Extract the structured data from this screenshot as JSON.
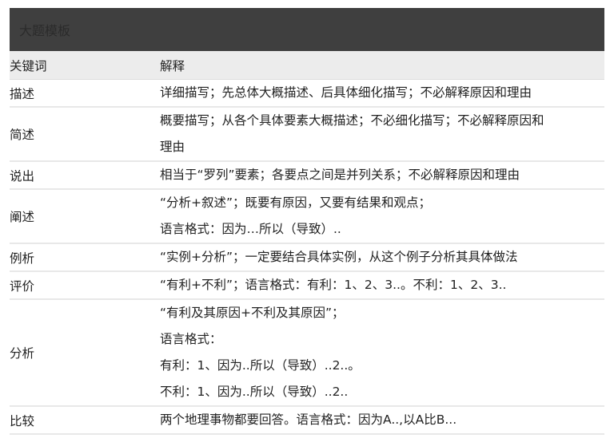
{
  "title": "大题模板",
  "table": {
    "headers": [
      "关键词",
      "解释"
    ],
    "rows": [
      {
        "key": "描述",
        "lines": [
          "详细描写；先总体大概描述、后具体细化描写；不必解释原因和理由"
        ]
      },
      {
        "key": "简述",
        "lines": [
          "概要描写；从各个具体要素大概描述；不必细化描写；不必解释原因和",
          "理由"
        ]
      },
      {
        "key": "说出",
        "lines": [
          "相当于“罗列”要素；各要点之间是并列关系；不必解释原因和理由"
        ]
      },
      {
        "key": "阐述",
        "lines": [
          "“分析+叙述”；既要有原因，又要有结果和观点；",
          "语言格式：因为…所以（导致）.."
        ]
      },
      {
        "key": "例析",
        "lines": [
          "“实例+分析”；一定要结合具体实例，从这个例子分析其具体做法"
        ]
      },
      {
        "key": "评价",
        "lines": [
          "“有利+不利”；语言格式：有利：1、2、3..。不利：1、2、3.."
        ]
      },
      {
        "key": "分析",
        "lines": [
          "“有利及其原因+不利及其原因”；",
          "语言格式：",
          "有利：1、因为..所以（导致）..2..。",
          "不利：1、因为..所以（导致）..2.."
        ]
      },
      {
        "key": "比较",
        "lines": [
          "两个地理事物都要回答。语言格式：因为A..,以A比B..."
        ]
      }
    ]
  }
}
